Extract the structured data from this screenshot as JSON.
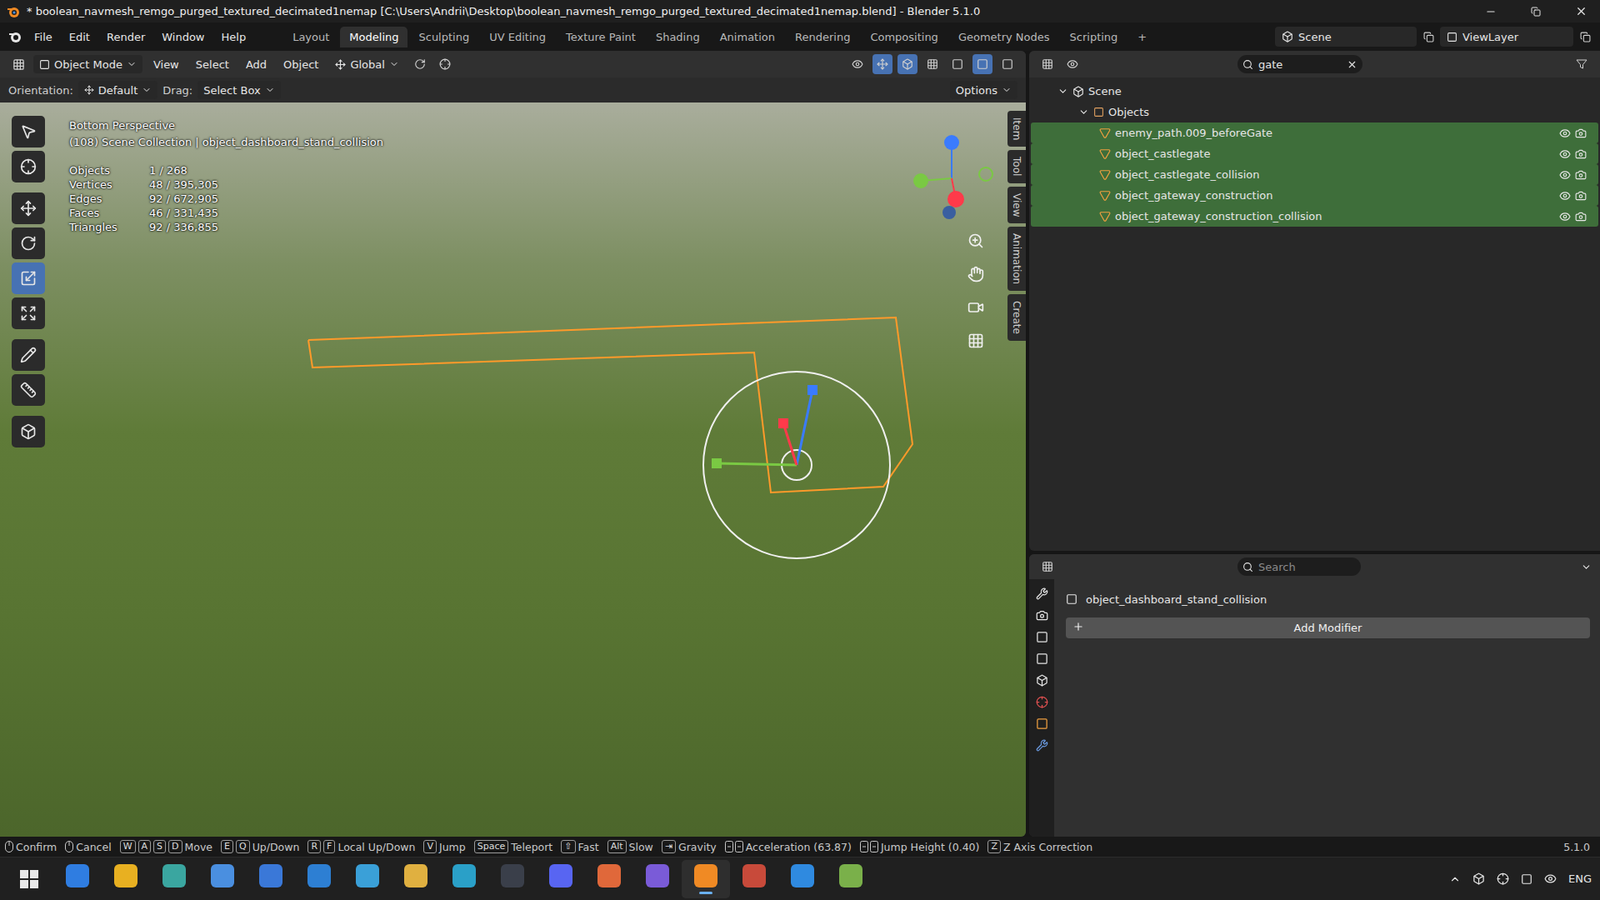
{
  "window": {
    "title": "* boolean_navmesh_remgo_purged_textured_decimated1nemap [C:\\Users\\Andrii\\Desktop\\boolean_navmesh_remgo_purged_textured_decimated1nemap.blend] - Blender 5.1.0"
  },
  "menus": [
    "File",
    "Edit",
    "Render",
    "Window",
    "Help"
  ],
  "workspaces": [
    {
      "label": "Layout",
      "selected": false
    },
    {
      "label": "Modeling",
      "selected": true
    },
    {
      "label": "Sculpting",
      "selected": false
    },
    {
      "label": "UV Editing",
      "selected": false
    },
    {
      "label": "Texture Paint",
      "selected": false
    },
    {
      "label": "Shading",
      "selected": false
    },
    {
      "label": "Animation",
      "selected": false
    },
    {
      "label": "Rendering",
      "selected": false
    },
    {
      "label": "Compositing",
      "selected": false
    },
    {
      "label": "Geometry Nodes",
      "selected": false
    },
    {
      "label": "Scripting",
      "selected": false
    }
  ],
  "add_workspace": "+",
  "scene": "Scene",
  "view_layer": "ViewLayer",
  "viewport": {
    "header": {
      "mode": "Object Mode",
      "menus": [
        "View",
        "Select",
        "Add",
        "Object"
      ],
      "transform": "Global"
    },
    "tool_settings": {
      "orientation_label": "Orientation:",
      "orientation": "Default",
      "drag_label": "Drag:",
      "drag": "Select Box",
      "options": "Options"
    },
    "overlay": {
      "view": "Bottom Perspective",
      "collection": "(108) Scene Collection | object_dashboard_stand_collision",
      "stats": [
        {
          "label": "Objects",
          "value": "1 / 268"
        },
        {
          "label": "Vertices",
          "value": "48 / 395,305"
        },
        {
          "label": "Edges",
          "value": "92 / 672,905"
        },
        {
          "label": "Faces",
          "value": "46 / 331,435"
        },
        {
          "label": "Triangles",
          "value": "92 / 336,855"
        }
      ]
    },
    "tools": [
      {
        "kind": "select",
        "selected": false
      },
      {
        "kind": "cursor",
        "selected": false
      },
      {
        "kind": "move",
        "selected": false
      },
      {
        "kind": "rotate",
        "selected": false
      },
      {
        "kind": "scale",
        "selected": true
      },
      {
        "kind": "transform",
        "selected": false
      },
      {
        "kind": "annotate",
        "selected": false
      },
      {
        "kind": "measure",
        "selected": false
      },
      {
        "kind": "add",
        "selected": false
      }
    ],
    "side_tabs": [
      "Item",
      "Tool",
      "View",
      "Animation",
      "Create"
    ]
  },
  "outliner": {
    "search": "gate",
    "tree": [
      {
        "label": "Scene",
        "depth": 0,
        "kind": "scene",
        "expanded": true,
        "matched": false
      },
      {
        "label": "Objects",
        "depth": 1,
        "kind": "collection",
        "expanded": true,
        "matched": false
      },
      {
        "label": "enemy_path.009_beforeGate",
        "depth": 2,
        "kind": "mesh",
        "expanded": false,
        "matched": true
      },
      {
        "label": "object_castlegate",
        "depth": 2,
        "kind": "mesh",
        "expanded": false,
        "matched": true
      },
      {
        "label": "object_castlegate_collision",
        "depth": 2,
        "kind": "mesh",
        "expanded": false,
        "matched": true
      },
      {
        "label": "object_gateway_construction",
        "depth": 2,
        "kind": "mesh",
        "expanded": false,
        "matched": true
      },
      {
        "label": "object_gateway_construction_collision",
        "depth": 2,
        "kind": "mesh",
        "expanded": false,
        "matched": true
      }
    ]
  },
  "properties": {
    "search_placeholder": "Search",
    "object": "object_dashboard_stand_collision",
    "button": "Add Modifier"
  },
  "status_bar": {
    "hints": [
      {
        "icon": "mouse",
        "keys": [],
        "label": "Confirm"
      },
      {
        "icon": "mouse",
        "keys": [],
        "label": "Cancel"
      },
      {
        "icon": "none",
        "keys": [
          "W",
          "A",
          "S",
          "D"
        ],
        "label": "Move"
      },
      {
        "icon": "none",
        "keys": [
          "E",
          "Q"
        ],
        "label": "Up/Down"
      },
      {
        "icon": "none",
        "keys": [
          "R",
          "F"
        ],
        "label": "Local Up/Down"
      },
      {
        "icon": "none",
        "keys": [
          "V"
        ],
        "label": "Jump"
      },
      {
        "icon": "none",
        "keys": [
          "Space"
        ],
        "label": "Teleport"
      },
      {
        "icon": "none",
        "keys": [
          "⇧"
        ],
        "label": "Fast"
      },
      {
        "icon": "none",
        "keys": [
          "Alt"
        ],
        "label": "Slow"
      },
      {
        "icon": "none",
        "keys": [
          "⇥"
        ],
        "label": "Gravity"
      },
      {
        "icon": "wheel",
        "keys": [],
        "label": "Acceleration (63.87)"
      },
      {
        "icon": "wheel",
        "keys": [],
        "label": "Jump Height (0.40)"
      },
      {
        "icon": "none",
        "keys": [
          "Z"
        ],
        "label": "Z Axis Correction"
      }
    ],
    "version": "5.1.0"
  },
  "taskbar": {
    "apps": [
      {
        "color": "#2f7de1",
        "active": false
      },
      {
        "color": "#e8b021",
        "active": false
      },
      {
        "color": "#3aa6a0",
        "active": false
      },
      {
        "color": "#4a8fe0",
        "active": false
      },
      {
        "color": "#3a78d8",
        "active": false
      },
      {
        "color": "#2d7fd3",
        "active": false
      },
      {
        "color": "#3aa0d8",
        "active": false
      },
      {
        "color": "#e0b040",
        "active": false
      },
      {
        "color": "#2aa0c8",
        "active": false
      },
      {
        "color": "#3a3f4a",
        "active": false
      },
      {
        "color": "#5865f2",
        "active": false
      },
      {
        "color": "#e0683a",
        "active": false
      },
      {
        "color": "#7a5bd8",
        "active": false
      },
      {
        "color": "#f08a24",
        "active": true
      },
      {
        "color": "#c84a3a",
        "active": false
      },
      {
        "color": "#2f8ae0",
        "active": false
      },
      {
        "color": "#7ab04a",
        "active": false
      }
    ],
    "language": "ENG"
  }
}
